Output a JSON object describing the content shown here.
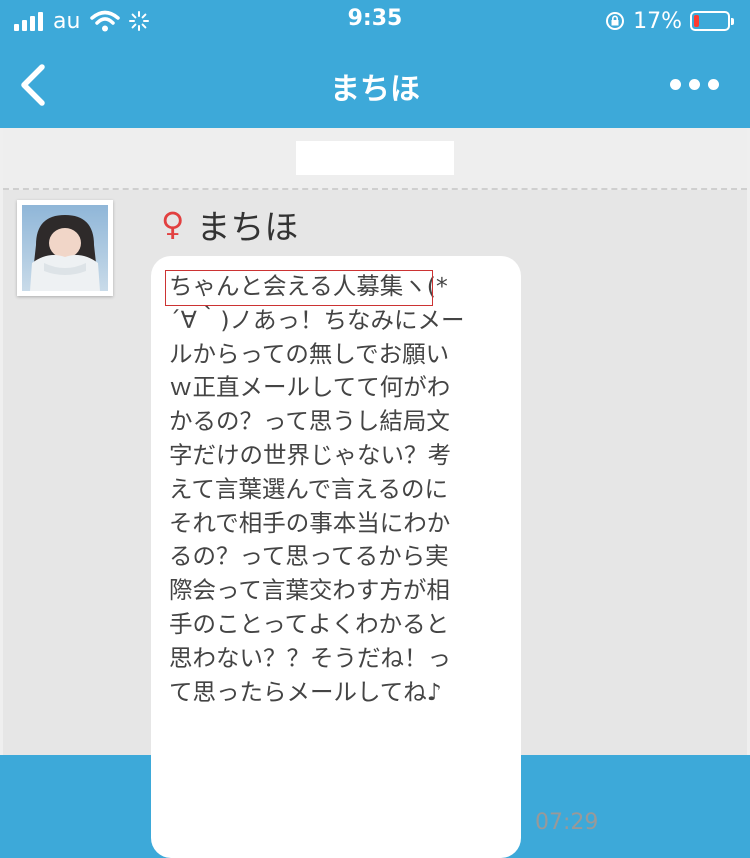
{
  "status_bar": {
    "carrier": "au",
    "time": "9:35",
    "battery_percent": "17%",
    "battery_level": 0.17
  },
  "nav": {
    "title": "まちほ",
    "back_icon": "chevron-left-icon",
    "more_icon": "ellipsis-icon"
  },
  "message": {
    "sender_gender_symbol": "♀",
    "sender_name": "まちほ",
    "text": "ちゃんと会える人募集ヽ(*\n´∀｀)ノあっ！ちなみにメー\nルからっての無しでお願い\nｗ正直メールしてて何がわ\nかるの？って思うし結局文\n字だけの世界じゃない？考\nえて言葉選んで言えるのに\nそれで相手の事本当にわか\nるの？って思ってるから実\n際会って言葉交わす方が相\n手のことってよくわかると\n思わない？？そうだね！っ\nて思ったらメールしてね♪",
    "time": "07:29"
  },
  "colors": {
    "header": "#3da9d9",
    "background": "#e6e6e6",
    "bubble": "#ffffff",
    "female_symbol": "#e24040",
    "highlight_box": "#cc3333",
    "battery_low": "#ff3b30"
  }
}
